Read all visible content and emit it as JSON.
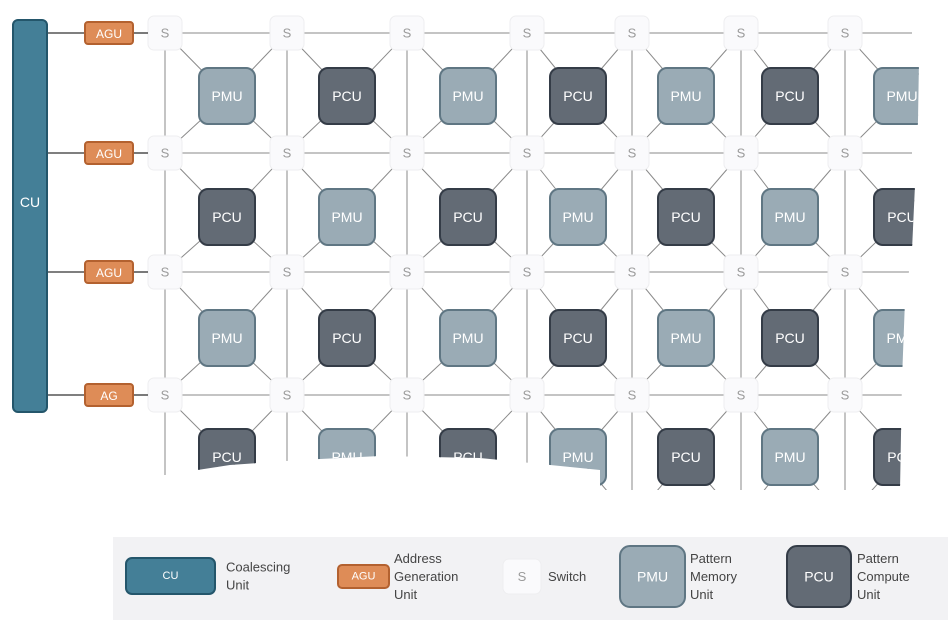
{
  "cu": {
    "label": "CU"
  },
  "agus": [
    "AGU",
    "AGU",
    "AGU",
    "AG"
  ],
  "switch_label": "S",
  "grid_rows": [
    [
      "PMU",
      "PCU",
      "PMU",
      "PCU",
      "PMU",
      "PCU",
      "PMU"
    ],
    [
      "PCU",
      "PMU",
      "PCU",
      "PMU",
      "PCU",
      "PMU",
      "PCU"
    ],
    [
      "PMU",
      "PCU",
      "PMU",
      "PCU",
      "PMU",
      "PCU",
      "PMU"
    ],
    [
      "PCU",
      "PMU",
      "PCU",
      "PMU",
      "PCU",
      "PMU",
      "PCU"
    ]
  ],
  "legend": [
    {
      "type": "CU",
      "box": "CU",
      "text": [
        "Coalescing",
        "Unit"
      ]
    },
    {
      "type": "AGU",
      "box": "AGU",
      "text": [
        "Address",
        "Generation",
        "Unit"
      ]
    },
    {
      "type": "S",
      "box": "S",
      "text": [
        "Switch"
      ]
    },
    {
      "type": "PMU",
      "box": "PMU",
      "text": [
        "Pattern",
        "Memory",
        "Unit"
      ]
    },
    {
      "type": "PCU",
      "box": "PCU",
      "text": [
        "Pattern",
        "Compute",
        "Unit"
      ]
    }
  ],
  "colors": {
    "CU": {
      "fill": "#447f97",
      "stroke": "#24566b"
    },
    "AGU": {
      "fill": "#de8c57",
      "stroke": "#b3612f"
    },
    "S": {
      "fill": "#fafafc",
      "stroke": "#eeeef0",
      "text": "#9a9a9a"
    },
    "PMU": {
      "fill": "#9aabb5",
      "stroke": "#5f7683"
    },
    "PCU": {
      "fill": "#636b75",
      "stroke": "#343c47"
    },
    "line": "#8a8a8a",
    "legend_bg": "#f2f2f4"
  }
}
